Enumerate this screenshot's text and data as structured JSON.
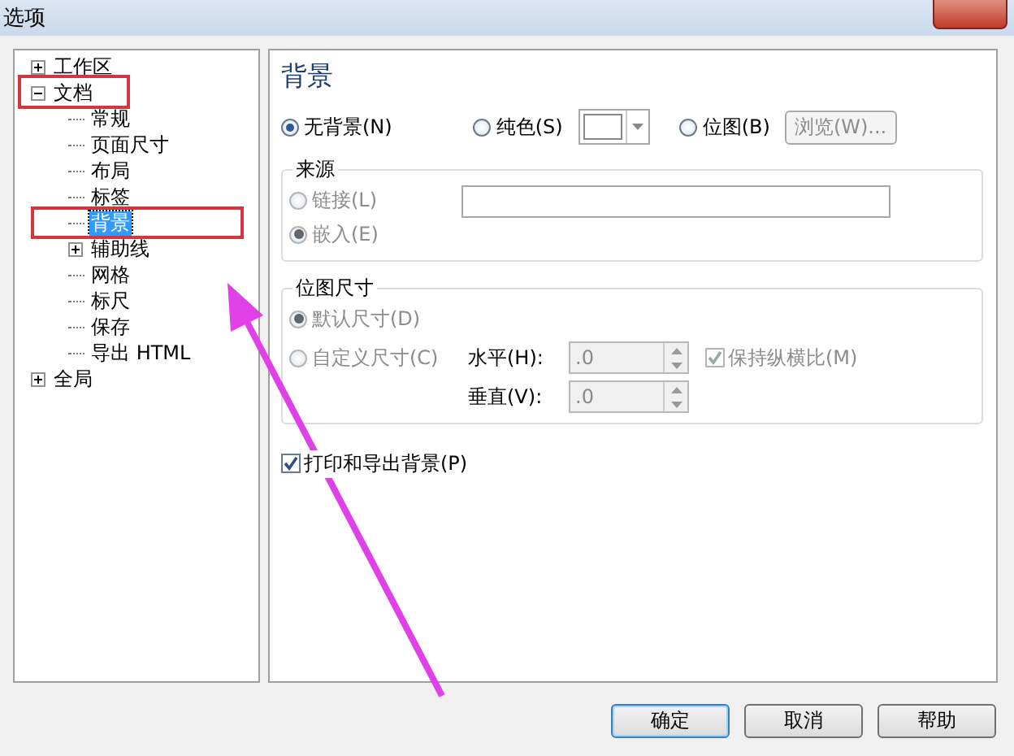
{
  "window": {
    "title": "选项"
  },
  "tree": [
    {
      "label": "工作区",
      "expanded": false,
      "selected": false,
      "highlighted": false
    },
    {
      "label": "文档",
      "expanded": true,
      "selected": false,
      "highlighted": true,
      "children": [
        {
          "label": "常规",
          "selected": false,
          "highlighted": false
        },
        {
          "label": "页面尺寸",
          "selected": false,
          "highlighted": false
        },
        {
          "label": "布局",
          "selected": false,
          "highlighted": false
        },
        {
          "label": "标签",
          "selected": false,
          "highlighted": false
        },
        {
          "label": "背景",
          "selected": true,
          "highlighted": true
        },
        {
          "label": "辅助线",
          "expanded": false,
          "selected": false,
          "highlighted": false
        },
        {
          "label": "网格",
          "selected": false,
          "highlighted": false
        },
        {
          "label": "标尺",
          "selected": false,
          "highlighted": false
        },
        {
          "label": "保存",
          "selected": false,
          "highlighted": false
        },
        {
          "label": "导出 HTML",
          "selected": false,
          "highlighted": false
        }
      ]
    },
    {
      "label": "全局",
      "expanded": false,
      "selected": false,
      "highlighted": false
    }
  ],
  "panel": {
    "heading": "背景",
    "fill_type": [
      {
        "label": "无背景(N)",
        "selected": true
      },
      {
        "label": "纯色(S)",
        "selected": false
      },
      {
        "label": "位图(B)",
        "selected": false
      }
    ],
    "browse_button": {
      "label": "浏览(W)...",
      "disabled": true
    },
    "source_group": {
      "title": "来源",
      "options": [
        {
          "label": "链接(L)",
          "selected": false,
          "disabled": true
        },
        {
          "label": "嵌入(E)",
          "selected": true,
          "disabled": true
        }
      ]
    },
    "size_group": {
      "title": "位图尺寸",
      "options": [
        {
          "label": "默认尺寸(D)",
          "selected": true,
          "disabled": true
        },
        {
          "label": "自定义尺寸(C)",
          "selected": false,
          "disabled": true
        }
      ],
      "fields": [
        {
          "label": "水平(H):",
          "value": ".0",
          "disabled": true
        },
        {
          "label": "垂直(V):",
          "value": ".0",
          "disabled": true
        }
      ],
      "keep_ratio": {
        "label": "保持纵横比(M)",
        "checked": true,
        "disabled": true
      }
    },
    "print_background": {
      "label": "打印和导出背景(P)",
      "checked": true,
      "disabled": false
    }
  },
  "buttons": [
    {
      "label": "确定",
      "default": true
    },
    {
      "label": "取消",
      "default": false
    },
    {
      "label": "帮助",
      "default": false
    }
  ],
  "annotation_arrow": true
}
